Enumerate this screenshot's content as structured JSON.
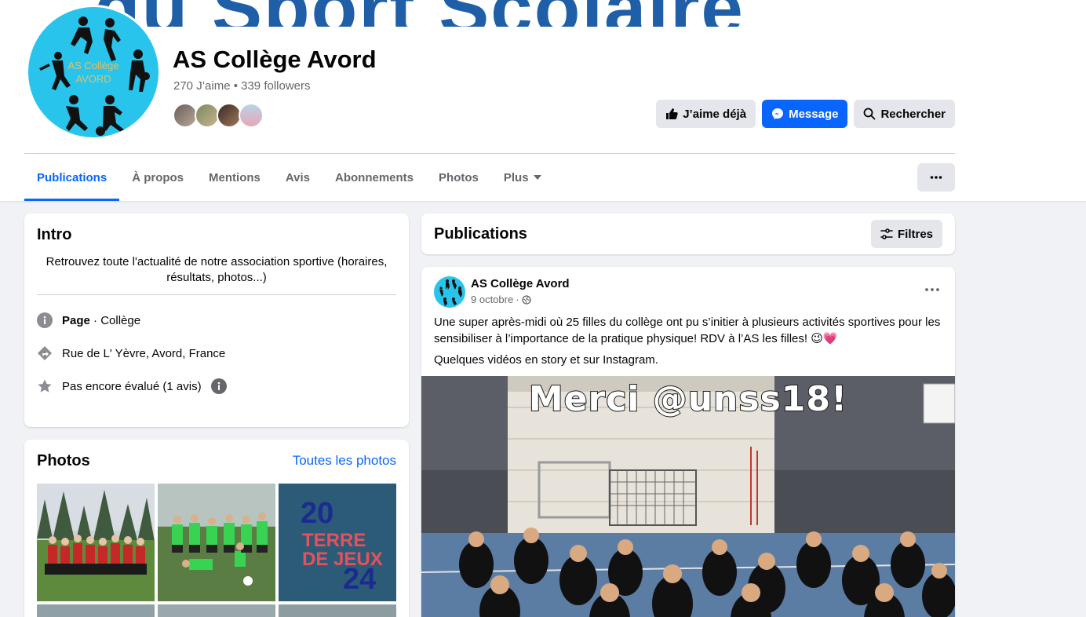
{
  "cover": {
    "text": "du Sport Scolaire"
  },
  "profile": {
    "avatar_label": "AS Collège AVORD",
    "name": "AS Collège Avord",
    "stats": "270 J’aime • 339 followers"
  },
  "actions": {
    "like": "J’aime déjà",
    "message": "Message",
    "search": "Rechercher"
  },
  "tabs": [
    {
      "label": "Publications",
      "active": true
    },
    {
      "label": "À propos"
    },
    {
      "label": "Mentions"
    },
    {
      "label": "Avis"
    },
    {
      "label": "Abonnements"
    },
    {
      "label": "Photos"
    },
    {
      "label": "Plus"
    }
  ],
  "intro": {
    "title": "Intro",
    "bio": "Retrouvez toute l'actualité de notre association sportive (horaires, résultats, photos...)",
    "page_label": "Page",
    "page_category": " · Collège",
    "address": "Rue de L' Yèvre, Avord, France",
    "rating": "Pas encore évalué (1 avis)"
  },
  "photos": {
    "title": "Photos",
    "see_all": "Toutes les photos",
    "badge_top": "20",
    "badge_mid1": "TERRE",
    "badge_mid2": "DE JEUX",
    "badge_bottom": "24"
  },
  "publications": {
    "title": "Publications",
    "filter": "Filtres"
  },
  "post": {
    "author": "AS Collège Avord",
    "date": "9 octobre",
    "text1": "Une super après-midi où 25 filles du collège ont pu s’initier à plusieurs activités sportives pour les sensibiliser à l’importance de la pratique physique! RDV à l’AS les filles! 😉💗",
    "text2": "Quelques vidéos en story et sur Instagram.",
    "media_caption": "Merci @unss18!"
  },
  "colors": {
    "accent": "#0866ff",
    "avatar_bg": "#29c4ec"
  }
}
